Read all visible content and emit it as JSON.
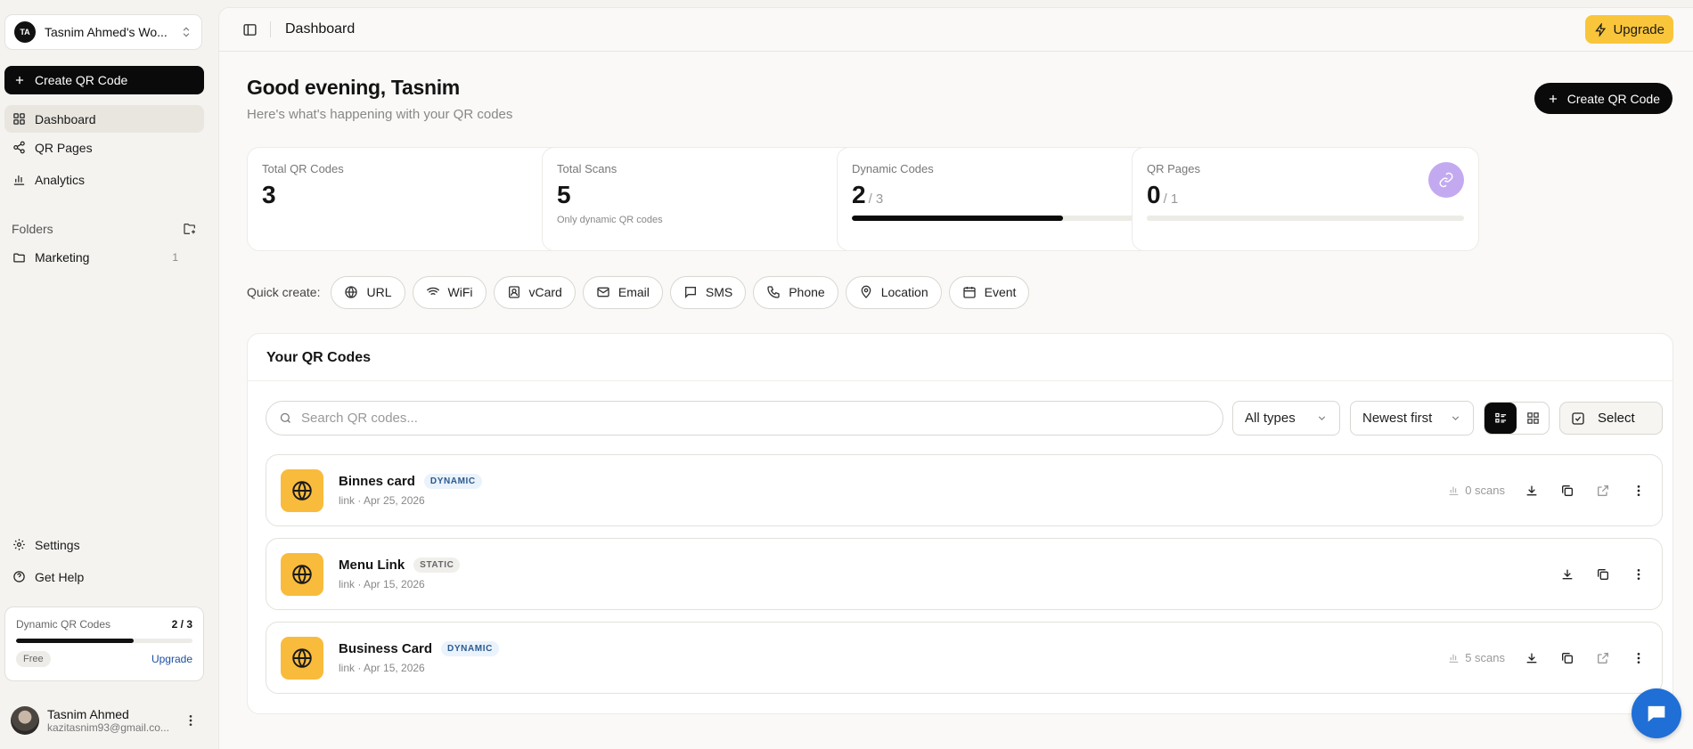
{
  "workspace": {
    "initials": "TA",
    "name": "Tasnim Ahmed's Wo..."
  },
  "sidebar": {
    "create_label": "Create QR Code",
    "nav": [
      {
        "label": "Dashboard",
        "active": true,
        "icon": "dashboard-icon"
      },
      {
        "label": "QR Pages",
        "icon": "share-icon"
      },
      {
        "label": "Analytics",
        "icon": "bar-chart-icon"
      }
    ],
    "folders_heading": "Folders",
    "folders": [
      {
        "label": "Marketing",
        "count": "1"
      }
    ],
    "bottom": [
      {
        "label": "Settings",
        "icon": "gear-icon"
      },
      {
        "label": "Get Help",
        "icon": "help-circle-icon"
      }
    ],
    "plan": {
      "label": "Dynamic QR Codes",
      "value": "2 / 3",
      "fraction": 0.667,
      "tier": "Free",
      "upgrade": "Upgrade"
    },
    "user": {
      "name": "Tasnim Ahmed",
      "email": "kazitasnim93@gmail.co..."
    }
  },
  "topbar": {
    "breadcrumb": "Dashboard",
    "upgrade_label": "Upgrade"
  },
  "header": {
    "greeting": "Good evening, Tasnim",
    "subtitle": "Here's what's happening with your QR codes",
    "create_label": "Create QR Code"
  },
  "stats": [
    {
      "label": "Total QR Codes",
      "value": "3",
      "icon": "qr-icon",
      "color": "#f9bb3c"
    },
    {
      "label": "Total Scans",
      "value": "5",
      "note": "Only dynamic QR codes",
      "icon": "bar-chart-icon",
      "color": "#3cc3ee"
    },
    {
      "label": "Dynamic Codes",
      "value": "2",
      "denom": "/ 3",
      "fraction": 0.667,
      "icon": "bolt-icon",
      "color": "#6fd6a0"
    },
    {
      "label": "QR Pages",
      "value": "0",
      "denom": "/ 1",
      "fraction": 0,
      "icon": "link-icon",
      "color": "#c3aaf0"
    }
  ],
  "quick": {
    "label": "Quick create:",
    "items": [
      "URL",
      "WiFi",
      "vCard",
      "Email",
      "SMS",
      "Phone",
      "Location",
      "Event"
    ]
  },
  "codes": {
    "title": "Your QR Codes",
    "search_placeholder": "Search QR codes...",
    "type_filter": "All types",
    "sort": "Newest first",
    "select_label": "Select",
    "rows": [
      {
        "name": "Binnes card",
        "badge": "DYNAMIC",
        "meta": "link · Apr 25, 2026",
        "scans": "0 scans"
      },
      {
        "name": "Menu Link",
        "badge": "STATIC",
        "meta": "link · Apr 15, 2026",
        "scans": null
      },
      {
        "name": "Business Card",
        "badge": "DYNAMIC",
        "meta": "link · Apr 15, 2026",
        "scans": "5 scans"
      }
    ]
  },
  "colors": {
    "accent": "#f9c53a",
    "dark": "#0a0a0a",
    "dynamic_badge": "#2a5a8f",
    "chat": "#1f6fd6"
  }
}
